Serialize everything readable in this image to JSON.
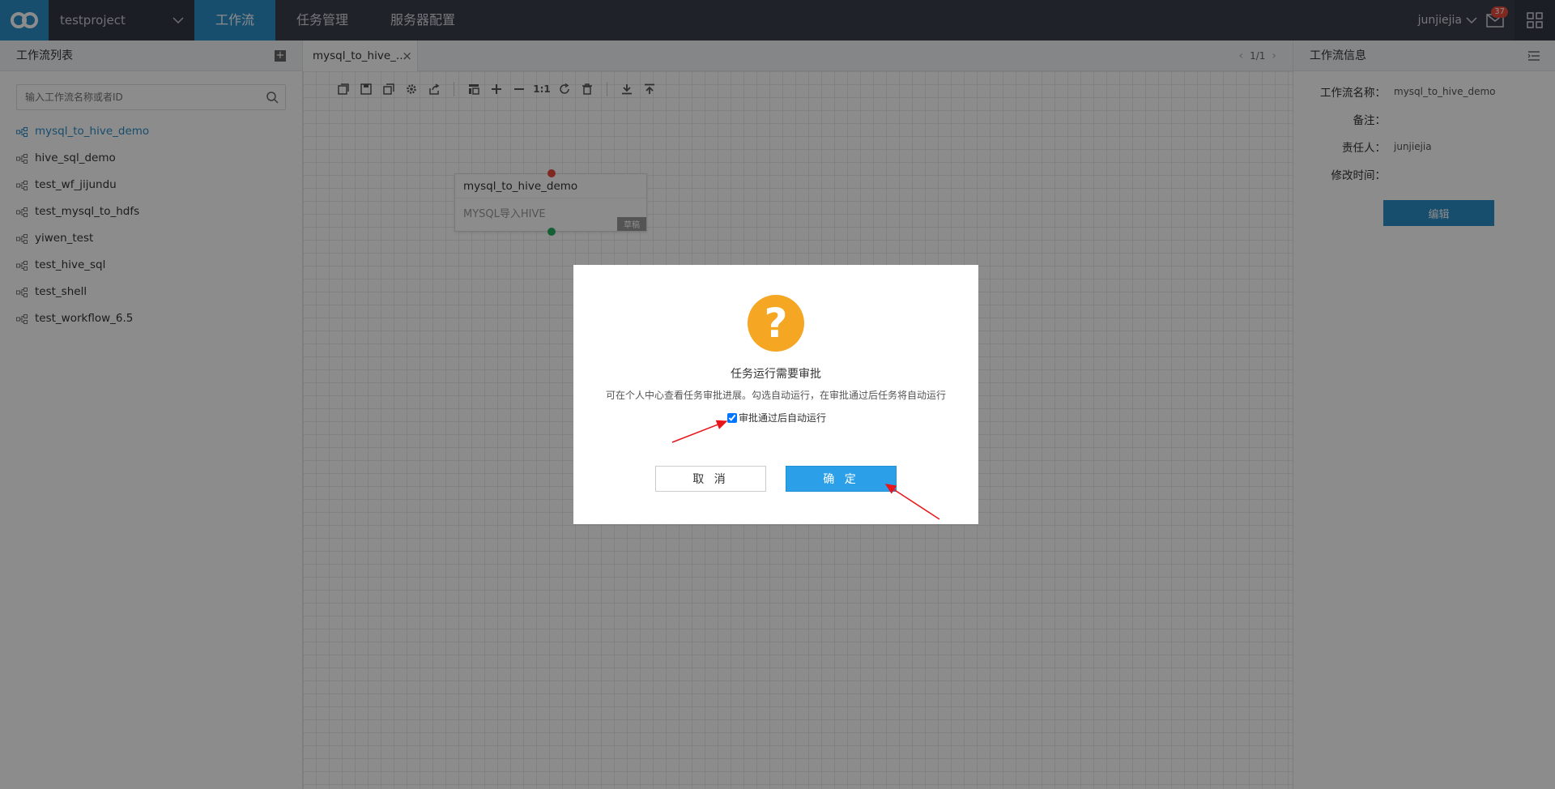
{
  "topbar": {
    "project": "testproject",
    "nav": [
      "工作流",
      "任务管理",
      "服务器配置"
    ],
    "user": "junjiejia",
    "mail_count": "37"
  },
  "left": {
    "title": "工作流列表",
    "search_placeholder": "输入工作流名称或者ID",
    "items": [
      "mysql_to_hive_demo",
      "hive_sql_demo",
      "test_wf_jijundu",
      "test_mysql_to_hdfs",
      "yiwen_test",
      "test_hive_sql",
      "test_shell",
      "test_workflow_6.5"
    ]
  },
  "tab": {
    "label": "mysql_to_hive_...",
    "close": "×",
    "pager": "1/1"
  },
  "toolbar": {
    "ratio_label": "1:1"
  },
  "node": {
    "title": "mysql_to_hive_demo",
    "desc": "MYSQL导入HIVE",
    "badge": "草稿"
  },
  "right": {
    "title": "工作流信息",
    "name_label": "工作流名称：",
    "name_value": "mysql_to_hive_demo",
    "remark_label": "备注：",
    "owner_label": "责任人：",
    "owner_value": "junjiejia",
    "modified_label": "修改时间：",
    "edit_label": "编辑"
  },
  "modal": {
    "icon": "?",
    "title": "任务运行需要审批",
    "desc": "可在个人中心查看任务审批进展。勾选自动运行，在审批通过后任务将自动运行",
    "checkbox_label": "审批通过后自动运行",
    "checkbox_checked": true,
    "cancel_label": "取 消",
    "ok_label": "确 定"
  },
  "colors": {
    "topbar": "#3b3f4b",
    "accent": "#2b8cc6",
    "warning": "#f5a623",
    "annotation": "#e8161b"
  }
}
